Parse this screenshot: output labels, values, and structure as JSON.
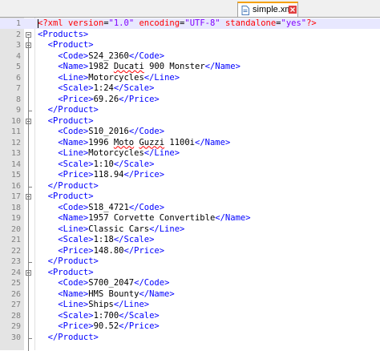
{
  "tab": {
    "label": "simple.xml",
    "icon": "file-icon",
    "close_icon": "close-icon"
  },
  "colors": {
    "tag": "#0000ff",
    "text": "#000000",
    "attribute": "#ff0000",
    "value": "#8000ff",
    "gutter": "#e4e4e4",
    "current_line": "#e8e8ff"
  },
  "lines": [
    {
      "num": "1",
      "parts": [
        [
          "pi",
          "<?xml "
        ],
        [
          "attr",
          "version"
        ],
        [
          "txt",
          "="
        ],
        [
          "str",
          "\"1.0\" "
        ],
        [
          "attr",
          "encoding"
        ],
        [
          "txt",
          "="
        ],
        [
          "str",
          "\"UTF-8\" "
        ],
        [
          "attr",
          "standalone"
        ],
        [
          "txt",
          "="
        ],
        [
          "str",
          "\"yes\""
        ],
        [
          "pi",
          "?>"
        ]
      ]
    },
    {
      "num": "2",
      "parts": [
        [
          "tag",
          "<Products>"
        ]
      ]
    },
    {
      "num": "3",
      "parts": [
        [
          "txt",
          "  "
        ],
        [
          "tag",
          "<Product>"
        ]
      ]
    },
    {
      "num": "4",
      "parts": [
        [
          "txt",
          "    "
        ],
        [
          "tag",
          "<Code>"
        ],
        [
          "txt",
          "S24_2360"
        ],
        [
          "tag",
          "</Code>"
        ]
      ]
    },
    {
      "num": "5",
      "parts": [
        [
          "txt",
          "    "
        ],
        [
          "tag",
          "<Name>"
        ],
        [
          "txt",
          "1982 "
        ],
        [
          "sq",
          "Ducati"
        ],
        [
          "txt",
          " 900 Monster"
        ],
        [
          "tag",
          "</Name>"
        ]
      ]
    },
    {
      "num": "6",
      "parts": [
        [
          "txt",
          "    "
        ],
        [
          "tag",
          "<Line>"
        ],
        [
          "txt",
          "Motorcycles"
        ],
        [
          "tag",
          "</Line>"
        ]
      ]
    },
    {
      "num": "7",
      "parts": [
        [
          "txt",
          "    "
        ],
        [
          "tag",
          "<Scale>"
        ],
        [
          "txt",
          "1:24"
        ],
        [
          "tag",
          "</Scale>"
        ]
      ]
    },
    {
      "num": "8",
      "parts": [
        [
          "txt",
          "    "
        ],
        [
          "tag",
          "<Price>"
        ],
        [
          "txt",
          "69.26"
        ],
        [
          "tag",
          "</Price>"
        ]
      ]
    },
    {
      "num": "9",
      "parts": [
        [
          "txt",
          "  "
        ],
        [
          "tag",
          "</Product>"
        ]
      ]
    },
    {
      "num": "10",
      "parts": [
        [
          "txt",
          "  "
        ],
        [
          "tag",
          "<Product>"
        ]
      ]
    },
    {
      "num": "11",
      "parts": [
        [
          "txt",
          "    "
        ],
        [
          "tag",
          "<Code>"
        ],
        [
          "txt",
          "S10_2016"
        ],
        [
          "tag",
          "</Code>"
        ]
      ]
    },
    {
      "num": "12",
      "parts": [
        [
          "txt",
          "    "
        ],
        [
          "tag",
          "<Name>"
        ],
        [
          "txt",
          "1996 "
        ],
        [
          "sq",
          "Moto"
        ],
        [
          "txt",
          " "
        ],
        [
          "sq",
          "Guzzi"
        ],
        [
          "txt",
          " 1100i"
        ],
        [
          "tag",
          "</Name>"
        ]
      ]
    },
    {
      "num": "13",
      "parts": [
        [
          "txt",
          "    "
        ],
        [
          "tag",
          "<Line>"
        ],
        [
          "txt",
          "Motorcycles"
        ],
        [
          "tag",
          "</Line>"
        ]
      ]
    },
    {
      "num": "14",
      "parts": [
        [
          "txt",
          "    "
        ],
        [
          "tag",
          "<Scale>"
        ],
        [
          "txt",
          "1:10"
        ],
        [
          "tag",
          "</Scale>"
        ]
      ]
    },
    {
      "num": "15",
      "parts": [
        [
          "txt",
          "    "
        ],
        [
          "tag",
          "<Price>"
        ],
        [
          "txt",
          "118.94"
        ],
        [
          "tag",
          "</Price>"
        ]
      ]
    },
    {
      "num": "16",
      "parts": [
        [
          "txt",
          "  "
        ],
        [
          "tag",
          "</Product>"
        ]
      ]
    },
    {
      "num": "17",
      "parts": [
        [
          "txt",
          "  "
        ],
        [
          "tag",
          "<Product>"
        ]
      ]
    },
    {
      "num": "18",
      "parts": [
        [
          "txt",
          "    "
        ],
        [
          "tag",
          "<Code>"
        ],
        [
          "txt",
          "S18_4721"
        ],
        [
          "tag",
          "</Code>"
        ]
      ]
    },
    {
      "num": "19",
      "parts": [
        [
          "txt",
          "    "
        ],
        [
          "tag",
          "<Name>"
        ],
        [
          "txt",
          "1957 Corvette Convertible"
        ],
        [
          "tag",
          "</Name>"
        ]
      ]
    },
    {
      "num": "20",
      "parts": [
        [
          "txt",
          "    "
        ],
        [
          "tag",
          "<Line>"
        ],
        [
          "txt",
          "Classic Cars"
        ],
        [
          "tag",
          "</Line>"
        ]
      ]
    },
    {
      "num": "21",
      "parts": [
        [
          "txt",
          "    "
        ],
        [
          "tag",
          "<Scale>"
        ],
        [
          "txt",
          "1:18"
        ],
        [
          "tag",
          "</Scale>"
        ]
      ]
    },
    {
      "num": "22",
      "parts": [
        [
          "txt",
          "    "
        ],
        [
          "tag",
          "<Price>"
        ],
        [
          "txt",
          "148.80"
        ],
        [
          "tag",
          "</Price>"
        ]
      ]
    },
    {
      "num": "23",
      "parts": [
        [
          "txt",
          "  "
        ],
        [
          "tag",
          "</Product>"
        ]
      ]
    },
    {
      "num": "24",
      "parts": [
        [
          "txt",
          "  "
        ],
        [
          "tag",
          "<Product>"
        ]
      ]
    },
    {
      "num": "25",
      "parts": [
        [
          "txt",
          "    "
        ],
        [
          "tag",
          "<Code>"
        ],
        [
          "txt",
          "S700_2047"
        ],
        [
          "tag",
          "</Code>"
        ]
      ]
    },
    {
      "num": "26",
      "parts": [
        [
          "txt",
          "    "
        ],
        [
          "tag",
          "<Name>"
        ],
        [
          "txt",
          "HMS Bounty"
        ],
        [
          "tag",
          "</Name>"
        ]
      ]
    },
    {
      "num": "27",
      "parts": [
        [
          "txt",
          "    "
        ],
        [
          "tag",
          "<Line>"
        ],
        [
          "txt",
          "Ships"
        ],
        [
          "tag",
          "</Line>"
        ]
      ]
    },
    {
      "num": "28",
      "parts": [
        [
          "txt",
          "    "
        ],
        [
          "tag",
          "<Scale>"
        ],
        [
          "txt",
          "1:700"
        ],
        [
          "tag",
          "</Scale>"
        ]
      ]
    },
    {
      "num": "29",
      "parts": [
        [
          "txt",
          "    "
        ],
        [
          "tag",
          "<Price>"
        ],
        [
          "txt",
          "90.52"
        ],
        [
          "tag",
          "</Price>"
        ]
      ]
    },
    {
      "num": "30",
      "parts": [
        [
          "txt",
          "  "
        ],
        [
          "tag",
          "</Product>"
        ]
      ]
    }
  ]
}
